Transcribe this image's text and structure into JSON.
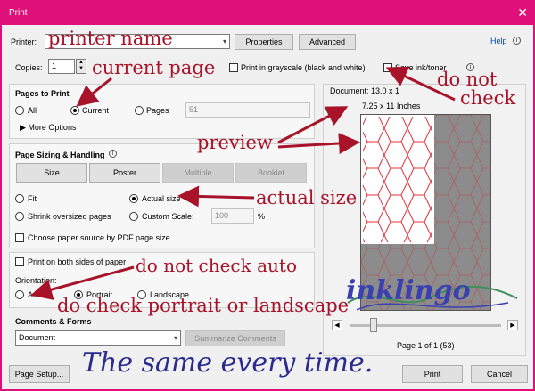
{
  "window": {
    "title": "Print",
    "close_glyph": "✕"
  },
  "printer": {
    "label": "Printer:",
    "value": "",
    "properties_label": "Properties",
    "advanced_label": "Advanced",
    "help_label": "Help"
  },
  "copies": {
    "label": "Copies:",
    "value": "1"
  },
  "options": {
    "grayscale_label": "Print in grayscale (black and white)",
    "save_ink_label": "Save ink/toner"
  },
  "pages_to_print": {
    "title": "Pages to Print",
    "all_label": "All",
    "current_label": "Current",
    "pages_label": "Pages",
    "pages_value": "51",
    "more_label": "More Options"
  },
  "sizing": {
    "title": "Page Sizing & Handling",
    "size_label": "Size",
    "poster_label": "Poster",
    "multiple_label": "Multiple",
    "booklet_label": "Booklet",
    "fit_label": "Fit",
    "actual_label": "Actual size",
    "shrink_label": "Shrink oversized pages",
    "custom_label": "Custom Scale:",
    "custom_value": "100",
    "percent": "%",
    "paper_source_label": "Choose paper source by PDF page size"
  },
  "duplex": {
    "label": "Print on both sides of paper"
  },
  "orientation": {
    "title": "Orientation:",
    "auto_label": "Auto",
    "portrait_label": "Portrait",
    "landscape_label": "Landscape"
  },
  "comments": {
    "title": "Comments & Forms",
    "value": "Document",
    "summarize_label": "Summarize Comments"
  },
  "preview": {
    "document_label": "Document: 13.0 x 1",
    "paper_size": "7.25 x 11 Inches",
    "page_status": "Page 1 of 1 (53)"
  },
  "footer": {
    "page_setup_label": "Page Setup...",
    "print_label": "Print",
    "cancel_label": "Cancel"
  },
  "annotations": {
    "printer_name": "printer name",
    "current_page": "current page",
    "do_not": "do not",
    "check": "check",
    "preview": "preview",
    "actual_size": "actual size",
    "do_not_check_auto": "do not check auto",
    "do_check": "do check portrait or landscape",
    "same_every_time": "The same every time.",
    "logo_text": "inklingo"
  },
  "colors": {
    "title_bar": "#e0107a",
    "annotation": "#a8132a",
    "tagline": "#2b2b8f",
    "logo_blue": "#3a40b0",
    "logo_green": "#3f8f5a",
    "hex_pattern": "#e0303a"
  }
}
